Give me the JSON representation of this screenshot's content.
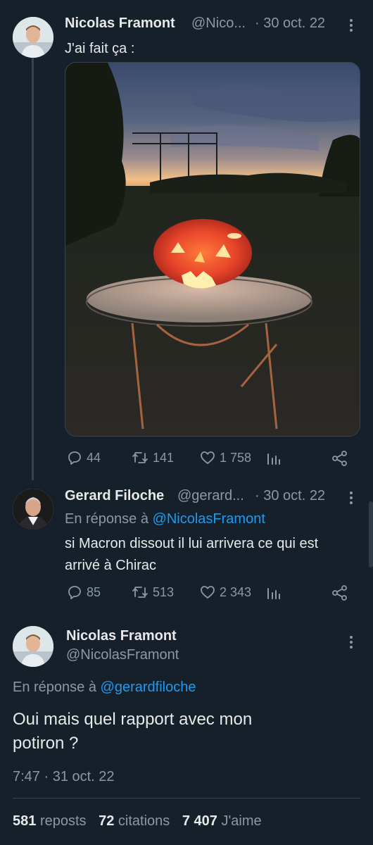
{
  "tweet1": {
    "name": "Nicolas Framont",
    "handle": "@Nico...",
    "date": "· 30 oct. 22",
    "text": "J'ai fait ça :",
    "replies": "44",
    "retweets": "141",
    "likes": "1 758"
  },
  "tweet2": {
    "name": "Gerard Filoche",
    "handle": "@gerard...",
    "date": "· 30 oct. 22",
    "reply_prefix": "En réponse à",
    "reply_to": "@NicolasFramont",
    "text_line1": "si Macron dissout il lui arrivera ce qui est",
    "text_line2": "arrivé à Chirac",
    "replies": "85",
    "retweets": "513",
    "likes": "2 343"
  },
  "tweet3": {
    "name": "Nicolas Framont",
    "handle": "@NicolasFramont",
    "reply_prefix": "En réponse à",
    "reply_to": "@gerardfiloche",
    "text_line1": "Oui mais quel rapport avec mon",
    "text_line2": "potiron ?",
    "timestamp": "7:47 · 31 oct. 22",
    "reposts_count": "581",
    "reposts_label": "reposts",
    "quotes_count": "72",
    "quotes_label": "citations",
    "likes_count": "7 407",
    "likes_label": "J'aime"
  },
  "icons": {
    "reply": "reply-icon",
    "retweet": "retweet-icon",
    "like": "heart-icon",
    "views": "analytics-icon",
    "share": "share-icon",
    "more": "more-dots-icon"
  },
  "colors": {
    "background": "#15202b",
    "text": "#e7e9ea",
    "muted": "#8b98a5",
    "link": "#1d9bf0",
    "divider": "#38444d"
  }
}
